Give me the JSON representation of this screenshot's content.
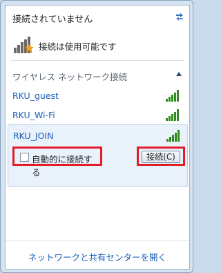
{
  "status": {
    "title": "接続されていません",
    "refresh_icon": "refresh-arrows-icon"
  },
  "access": {
    "text": "接続は使用可能です",
    "icon": "signal-star-icon"
  },
  "section": {
    "title": "ワイヤレス ネットワーク接続",
    "collapse_icon": "chevron-up-icon"
  },
  "networks": [
    {
      "name": "RKU_guest",
      "signal": "full"
    },
    {
      "name": "RKU_Wi-Fi",
      "signal": "full"
    },
    {
      "name": "RKU_JOIN",
      "signal": "full",
      "selected": true
    }
  ],
  "selected_options": {
    "autoconnect_label": "自動的に接続する",
    "autoconnect_checked": false,
    "connect_label": "接続(C)"
  },
  "footer": {
    "link": "ネットワークと共有センターを開く"
  },
  "colors": {
    "highlight": "#e11d2a",
    "link": "#1a5fb4",
    "signal": "#2f8a1f"
  }
}
